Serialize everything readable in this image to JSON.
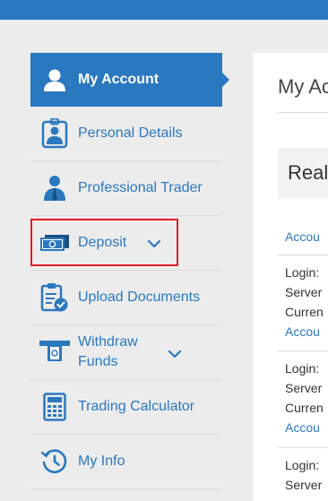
{
  "colors": {
    "accent": "#2a78c0",
    "highlight": "#e21b23"
  },
  "sidebar": {
    "items": [
      {
        "label": "My Account",
        "icon": "user-icon",
        "active": true
      },
      {
        "label": "Personal Details",
        "icon": "id-badge-icon"
      },
      {
        "label": "Professional Trader",
        "icon": "businessman-icon"
      },
      {
        "label": "Deposit",
        "icon": "banknote-icon",
        "has_dropdown": true
      },
      {
        "label": "Upload Documents",
        "icon": "clipboard-check-icon"
      },
      {
        "label_line1": "Withdraw",
        "label_line2": "Funds",
        "icon": "atm-cash-icon",
        "has_dropdown": true
      },
      {
        "label": "Trading Calculator",
        "icon": "calculator-icon"
      },
      {
        "label": "My Info",
        "icon": "history-icon"
      }
    ]
  },
  "main": {
    "title": "My Ac",
    "section_title": "Real",
    "header_link": "Accou",
    "entries": [
      {
        "login": "Login:",
        "server": "Server",
        "currency": "Curren",
        "link": "Accou"
      },
      {
        "login": "Login:",
        "server": "Server",
        "currency": "Curren",
        "link": "Accou"
      },
      {
        "login": "Login:",
        "server": "Server"
      }
    ]
  }
}
